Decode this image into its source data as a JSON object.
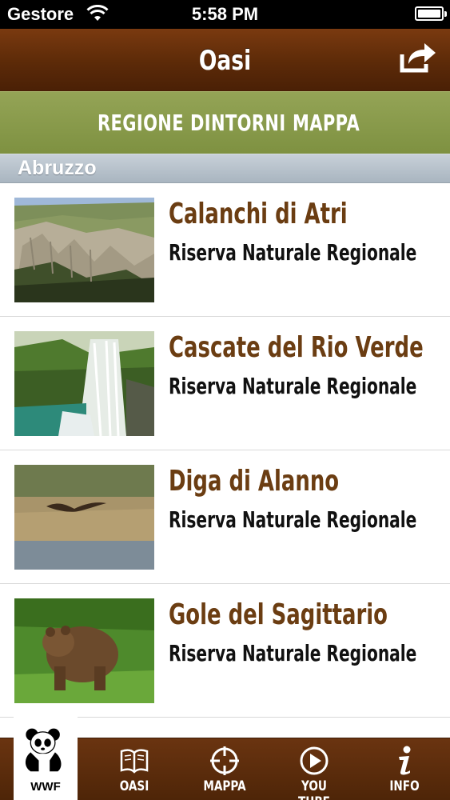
{
  "status_bar": {
    "carrier": "Gestore",
    "time": "5:58 PM"
  },
  "nav_bar": {
    "title": "Oasi",
    "share_icon": "share-arrow-icon"
  },
  "segments": [
    {
      "label": "REGIONE"
    },
    {
      "label": "DINTORNI"
    },
    {
      "label": "MAPPA"
    }
  ],
  "section": {
    "title": "Abruzzo"
  },
  "items": [
    {
      "name": "Calanchi di Atri",
      "type": "Riserva Naturale Regionale",
      "image": "badlands-landscape"
    },
    {
      "name": "Cascate del Rio Verde",
      "type": "Riserva Naturale Regionale",
      "image": "waterfall"
    },
    {
      "name": "Diga di Alanno",
      "type": "Riserva Naturale Regionale",
      "image": "bird-over-lake"
    },
    {
      "name": "Gole del Sagittario",
      "type": "Riserva Naturale Regionale",
      "image": "brown-bear"
    }
  ],
  "tab_bar": {
    "logo_text": "WWF",
    "tabs": [
      {
        "label": "OASI",
        "icon": "book-icon"
      },
      {
        "label": "MAPPA",
        "icon": "crosshair-icon"
      },
      {
        "label": "YOU TUBE",
        "icon": "play-icon"
      },
      {
        "label": "INFO",
        "icon": "info-icon"
      }
    ]
  },
  "colors": {
    "nav_brown": "#5c2a08",
    "segment_green": "#869948",
    "title_brown": "#6b3d12"
  }
}
